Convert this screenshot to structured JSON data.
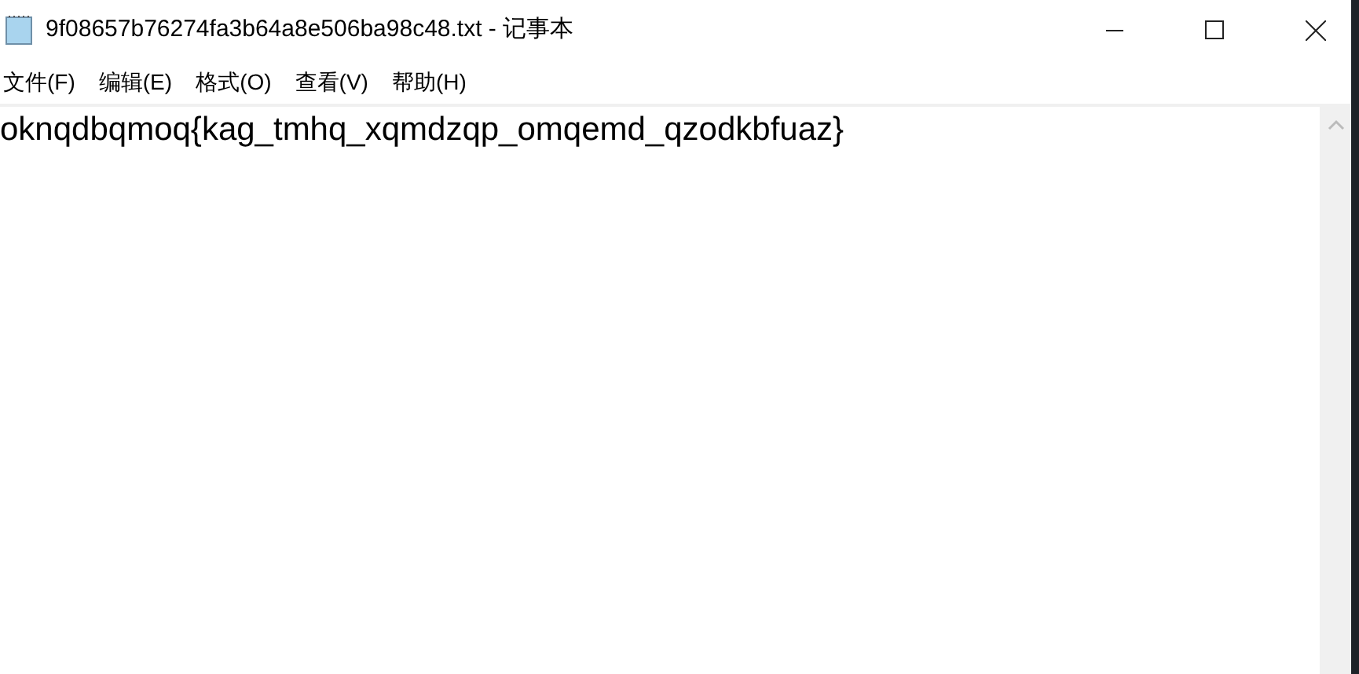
{
  "window": {
    "title": "9f08657b76274fa3b64a8e506ba98c48.txt - 记事本"
  },
  "menu": [
    {
      "label": "文件(F)"
    },
    {
      "label": "编辑(E)"
    },
    {
      "label": "格式(O)"
    },
    {
      "label": "查看(V)"
    },
    {
      "label": "帮助(H)"
    }
  ],
  "editor": {
    "text": "oknqdbqmoq{kag_tmhq_xqmdzqp_omqemd_qzodkbfuaz}"
  }
}
